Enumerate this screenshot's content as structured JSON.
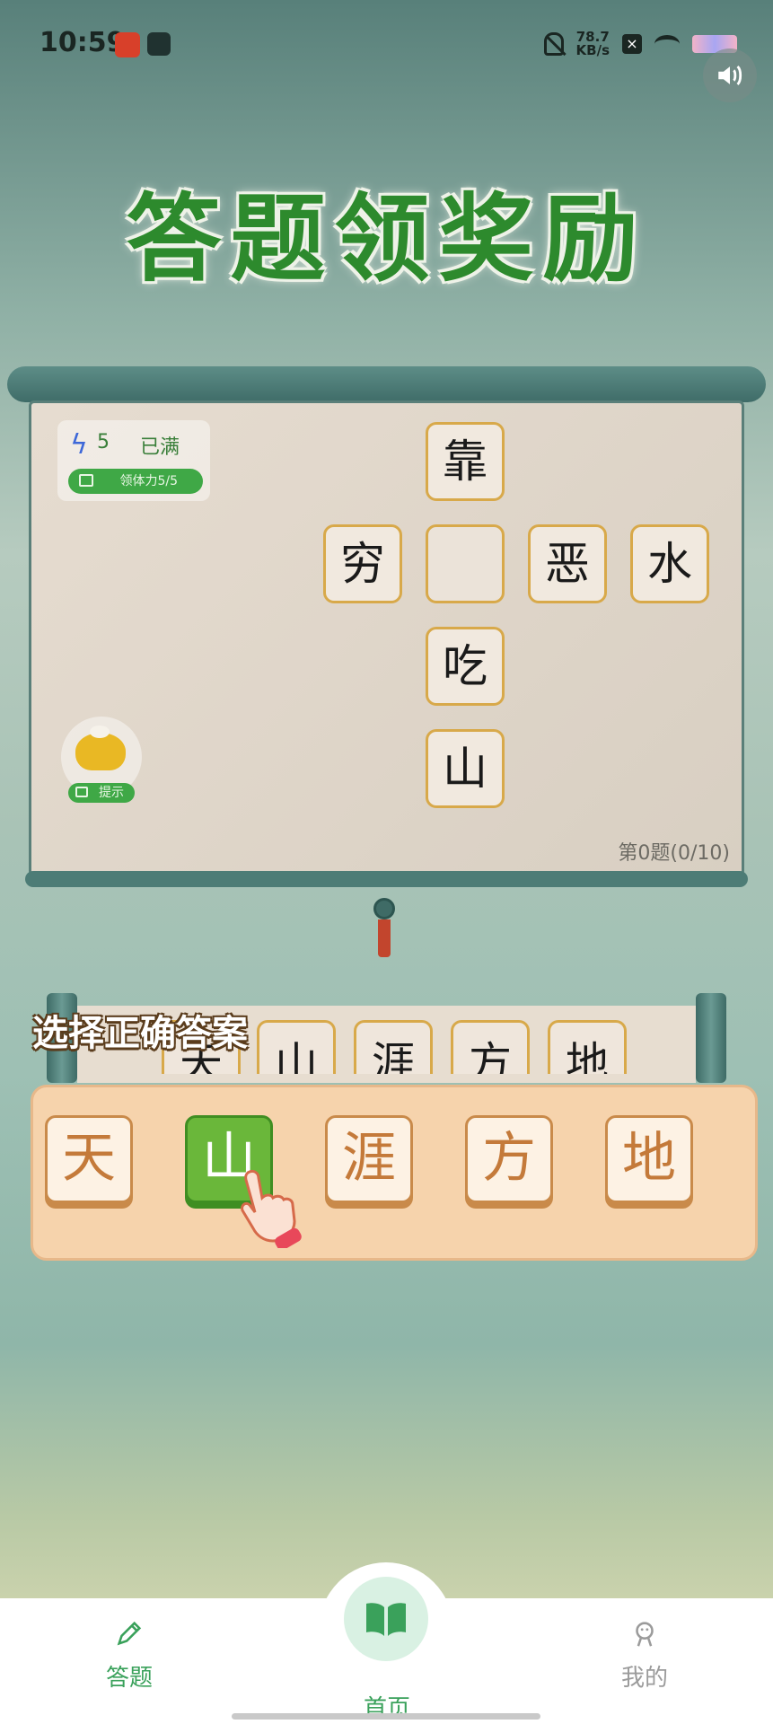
{
  "status_bar": {
    "time": "10:59",
    "net_speed_value": "78.7",
    "net_speed_unit": "KB/s"
  },
  "game": {
    "title": "答题领奖励",
    "stamina": {
      "count": "5",
      "status": "已满",
      "button_label": "领体力5/5"
    },
    "grid": {
      "top": "靠",
      "left": "穷",
      "center": "",
      "right1": "恶",
      "right2": "水",
      "below1": "吃",
      "below2": "山"
    },
    "hint_label": "提示",
    "progress": "第0题(0/10)",
    "prompt": "选择正确答案",
    "options": [
      "天",
      "山",
      "涯",
      "方",
      "地"
    ],
    "selected_option_index": 1
  },
  "nav": {
    "items": [
      {
        "label": "答题",
        "icon": "pencil-icon"
      },
      {
        "label": "首页",
        "icon": "book-icon"
      },
      {
        "label": "我的",
        "icon": "profile-icon"
      }
    ],
    "active_color": "#3aa15b",
    "inactive_color": "#9b9b9b"
  }
}
